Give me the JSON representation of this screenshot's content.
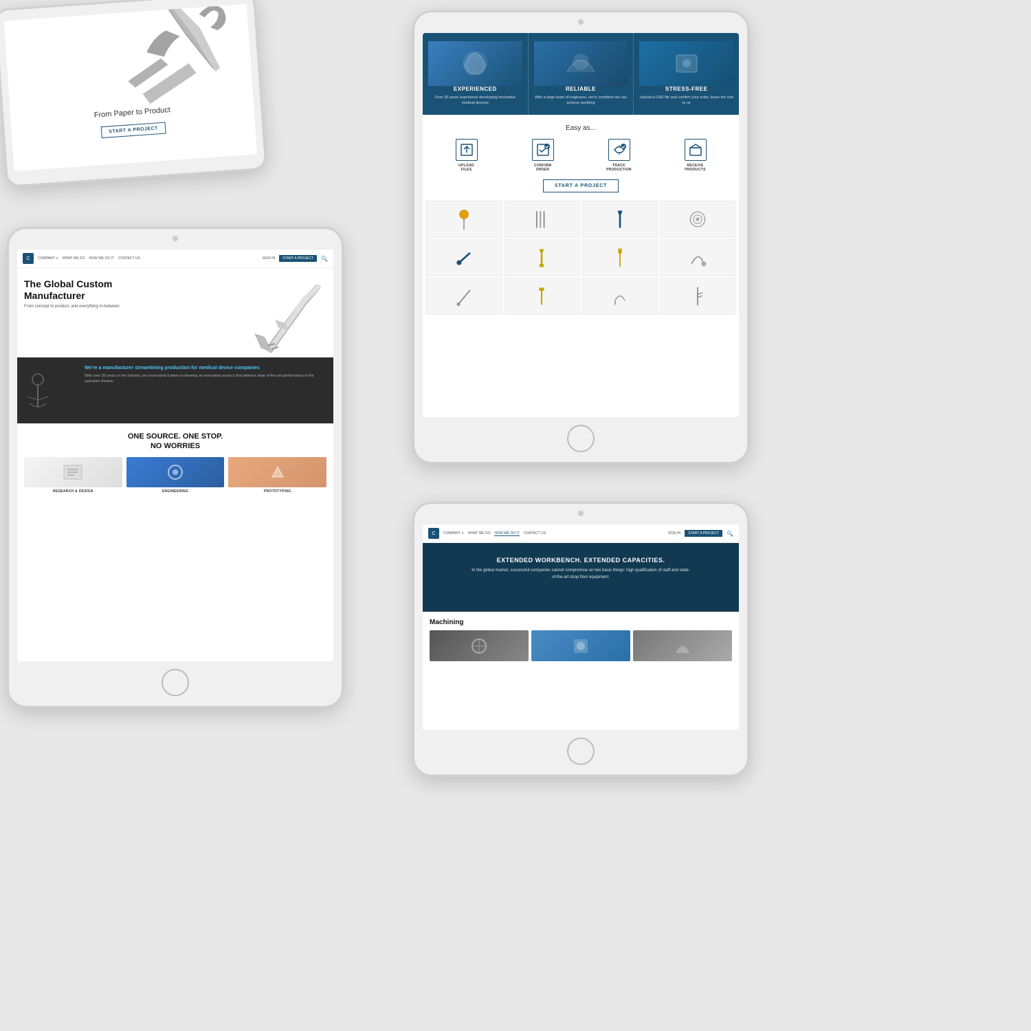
{
  "page": {
    "background": "#e8e8e8"
  },
  "tablet1": {
    "hero_text": "From Paper to Product",
    "btn_label": "START A PROJECT"
  },
  "tablet2": {
    "nav": {
      "logo": "C",
      "links": [
        "COMPANY ∨",
        "WHAT WE DO",
        "HOW WE DO IT",
        "CONTACT US"
      ],
      "signin": "SIGN IN",
      "btn": "START A PROJECT"
    },
    "hero": {
      "title_line1": "The Global Custom",
      "title_line2": "Manufacturer",
      "subtitle": "From concept to product, and everything in-between"
    },
    "dark_section": {
      "title": "We're a manufacturer streamlining production for medical device companies",
      "body": "With over 30 years in the industry, we know what it takes to develop an innovative product that delivers state of the art performance in the operation theatre."
    },
    "one_source": {
      "title_line1": "ONE SOURCE. ONE STOP.",
      "title_line2": "NO WORRIES"
    },
    "cards": [
      {
        "label": "RESEARCH & DESIGN"
      },
      {
        "label": "ENGINEERING"
      },
      {
        "label": "PROTOTYPING"
      }
    ]
  },
  "tablet3": {
    "banner": {
      "cols": [
        {
          "title": "EXPERIENCED",
          "body": "Over 30 years experience developing innovative medical devices"
        },
        {
          "title": "RELIABLE",
          "body": "With a large team of engineers, we're confident we can achieve anything"
        },
        {
          "title": "STRESS-FREE",
          "body": "Upload a CAD file and confirm your order, leave the rest to us"
        }
      ]
    },
    "easy": {
      "title": "Easy as...",
      "steps": [
        {
          "icon": "⬆",
          "label": "UPLOAD\nFILES"
        },
        {
          "icon": "✓",
          "label": "CONFIRM\nORDER"
        },
        {
          "icon": "⬡",
          "label": "TRACK\nPRODUCTION"
        },
        {
          "icon": "□",
          "label": "RECEIVE\nPRODUCTS"
        }
      ],
      "btn": "START A PROJECT"
    },
    "grid": {
      "rows": 3,
      "cols": 4
    }
  },
  "tablet4": {
    "nav": {
      "logo": "C",
      "links": [
        "COMPANY ∨",
        "WHAT WE DO",
        "HOW WE DO IT",
        "CONTACT US"
      ],
      "active": "HOW WE DO IT",
      "signin": "SIGN IN",
      "btn": "START A PROJECT"
    },
    "hero": {
      "title": "EXTENDED WORKBENCH. EXTENDED CAPACITIES.",
      "body": "In the global market, successful companies cannot compromise on two basic things: high qualification of staff and state-of-the-art shop floor equipment."
    },
    "machining": {
      "title": "Machining"
    }
  }
}
